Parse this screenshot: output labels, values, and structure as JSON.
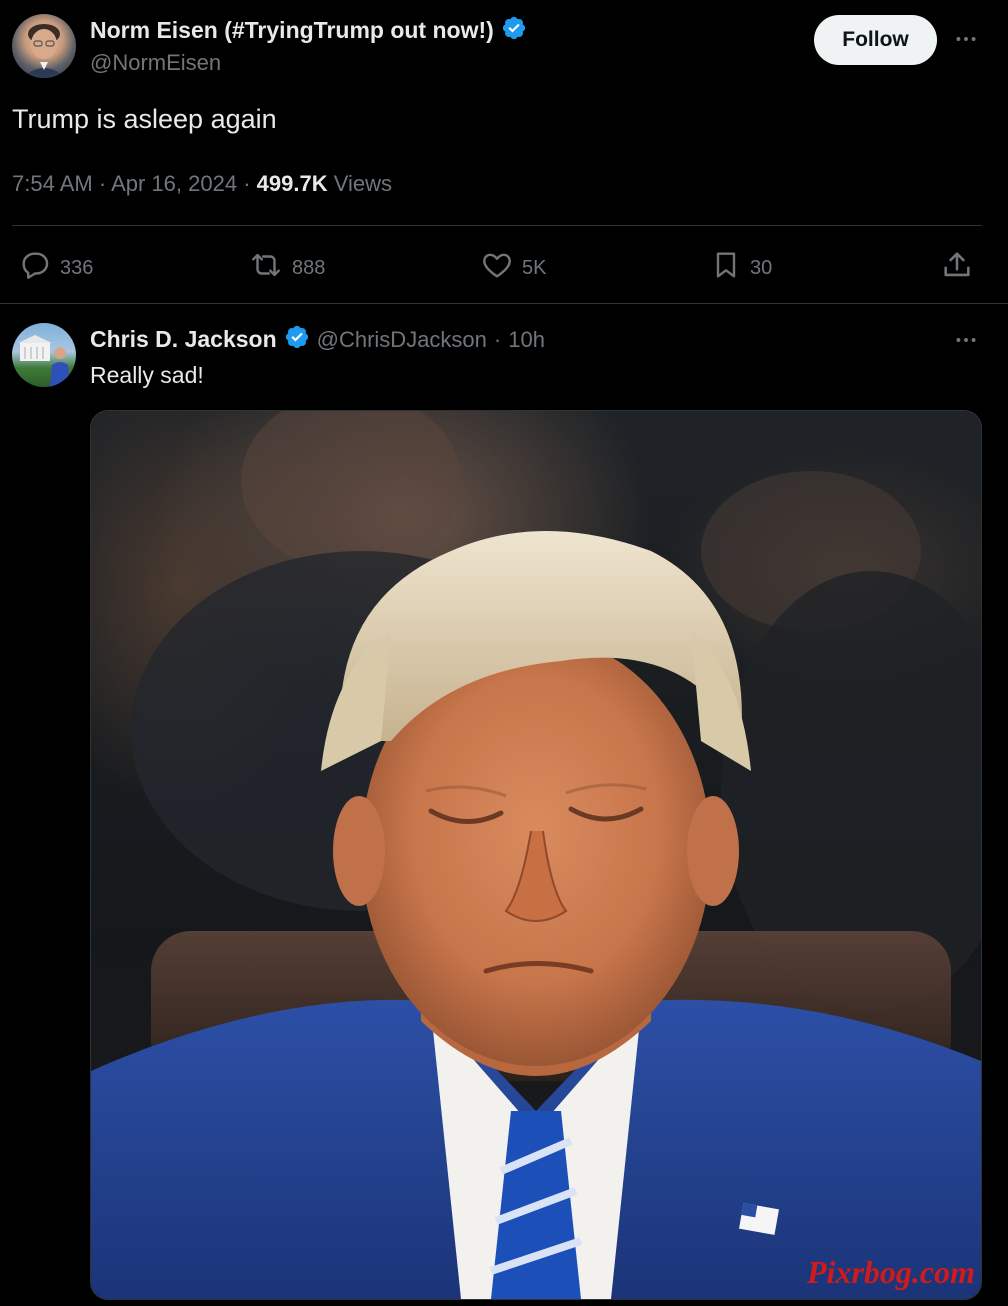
{
  "main_tweet": {
    "author_name": "Norm Eisen (#TryingTrump out now!)",
    "author_handle": "@NormEisen",
    "follow_label": "Follow",
    "text": "Trump is asleep again",
    "time": "7:54 AM",
    "date": "Apr 16, 2024",
    "views_count": "499.7K",
    "views_label": "Views",
    "stats": {
      "replies": "336",
      "reposts": "888",
      "likes": "5K",
      "bookmarks": "30"
    }
  },
  "reply": {
    "author_name": "Chris D. Jackson",
    "author_handle": "@ChrisDJackson",
    "age": "10h",
    "text": "Really sad!",
    "watermark": "Pixrbog.com"
  },
  "colors": {
    "background": "#000000",
    "text": "#e7e9ea",
    "secondary": "#71767b",
    "verified": "#1d9bf0",
    "divider": "#2f3336",
    "watermark": "#d11a1a"
  },
  "icons": [
    "verified-badge-icon",
    "more-icon",
    "reply-icon",
    "repost-icon",
    "like-icon",
    "bookmark-icon",
    "share-icon"
  ]
}
